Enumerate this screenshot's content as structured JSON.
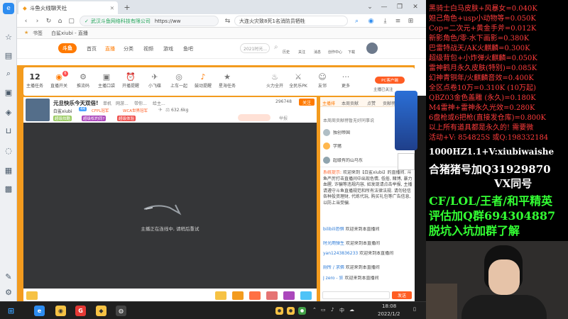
{
  "browser": {
    "tab_title": "斗鱼火线聊天社",
    "address_prefix": "武汉斗鱼网络科技有限公司",
    "address_url": "https://ww",
    "search_hint": "大连火灾致8死1名消防员牺牲",
    "bookmark_label": "书签",
    "bookmark_tab": "白鲨xiubi - 直播",
    "apps_label": "应用"
  },
  "douyu": {
    "logo": "斗鱼",
    "nav": [
      "首页",
      "直播",
      "分类",
      "视频",
      "游戏",
      "鱼吧"
    ],
    "search_placeholder": "2021时光...",
    "user_menu": [
      "历史",
      "关注",
      "消息",
      "创作中心",
      "下载"
    ],
    "categories": [
      {
        "label": "主播任务",
        "icon": "12"
      },
      {
        "label": "直播开关",
        "icon": "◉"
      },
      {
        "label": "推流码",
        "icon": "⚙"
      },
      {
        "label": "主播口袋",
        "icon": "▣"
      },
      {
        "label": "开播提醒",
        "icon": "⏰"
      },
      {
        "label": "小飞碟",
        "icon": "✈"
      },
      {
        "label": "上车一起",
        "icon": "◎"
      },
      {
        "label": "鼓动提醒",
        "icon": "♪"
      },
      {
        "label": "星海任务",
        "icon": "★"
      },
      {
        "label": "火力全开",
        "icon": "♨"
      },
      {
        "label": "全民乐PK",
        "icon": "⚔"
      },
      {
        "label": "友邻",
        "icon": "☺"
      },
      {
        "label": "更多",
        "icon": "···"
      }
    ],
    "cat_badge": "6",
    "pc_button": "PC客户端",
    "share_label": "主播已关注"
  },
  "stream": {
    "title": "元旦快乐今天双倍!",
    "tags": [
      "单机",
      "网游...",
      "带你...",
      "给主..."
    ],
    "streamer_name": "白鲨xiubi",
    "level": "44",
    "medals": [
      "CFPL冠军",
      "WCA世界冠军"
    ],
    "badges": [
      "超级炫酷",
      "超级松的同?",
      "超级体验"
    ],
    "weight": "632.6kg",
    "fans": "296748",
    "follow_button": "关注",
    "report_label": "举报",
    "notice": "主播正在连线中, 请稍后重试"
  },
  "chat": {
    "tabs": [
      "主播排",
      "本周贡献",
      "点赞",
      "贡献榜"
    ],
    "rank_note": "本周周贡献榜暂无好同事说",
    "viewers": [
      {
        "name": "独创帝国",
        "medal": "v4"
      },
      {
        "name": "学猪",
        "medal": "v2"
      },
      {
        "name": "超级有的山马东",
        "medal": "v1"
      }
    ],
    "system_label": "系统提示:",
    "system_msg": "欢迎来到【白鲨xiubi】的直播间. 斗鱼严厉打击直播间中出现色情, 低俗, 赌博, 暴力血腥, 诈骗等违规内容, 如发现请点击举报, 主播请遵守斗鱼直播规范和所有法律法规. 请勿轻信各种投资理财, 代练代玩, 购买礼包等广告信息, 以防上当受骗.",
    "messages": [
      {
        "user": "bilibili恐惧",
        "text": "欢迎来到本直播间"
      },
      {
        "user": "时光雨弹生",
        "text": "欢迎来到本直播间"
      },
      {
        "user": "yan1243836233",
        "text": "欢迎来到本直播间"
      },
      {
        "user": "厕所 / 求佛",
        "text": "欢迎来到本直播间"
      },
      {
        "user": "J zero - 狂",
        "text": "欢迎来到本直播间"
      }
    ],
    "send_label": "发送"
  },
  "overlay": {
    "red_lines": [
      "黑骑士白马皮肤+风暴女=0.040K",
      "妲己角色+usp小动物等=0.050K",
      "Cop=二次元+黄金手斧=0.012K",
      "新影角色/零-水下画影=0.380K",
      "巴雷特战天/AK火麒麟=0.300K",
      "超级背包+小炸弹火麒麟=0.050K",
      "雷神鹤月永久皮肤(特别)=0.085K",
      "幻神青铜年/火麒麟音效=0.400K",
      "全区点卷10万=0.310K (10万起)",
      "QBZ03金色盖雕 (永久)=0.180K",
      "M4雷神+雷神永久光效=0.280K",
      "6盘枪或6把枪(直接发仓库)=0.800K",
      "以上所有道具都是永久的! 需要微",
      "活动+V: 854825S  或Q:198332184"
    ],
    "white_line1": "1000HZ1.1+V:xiubiwaishe",
    "white_line2": "合猪猪号加Q31929870",
    "white_line3": "VX同号",
    "green_line1": "CF/LOL/王者/和平精英",
    "green_line2": "评估加Q群694304887",
    "green_line3": "脱坑入坑加群了解"
  },
  "taskbar": {
    "time": "18:08",
    "date": "2022/1/2",
    "ime": "中",
    "apps": [
      "start",
      "chrome",
      "yellow-app",
      "game-app",
      "douyu-app",
      "media-app"
    ]
  },
  "colors": {
    "douyu_orange": "#f39b1e",
    "player_bg": "#353638",
    "overlay_red": "#ff3b3b",
    "overlay_green": "#33ff33"
  }
}
